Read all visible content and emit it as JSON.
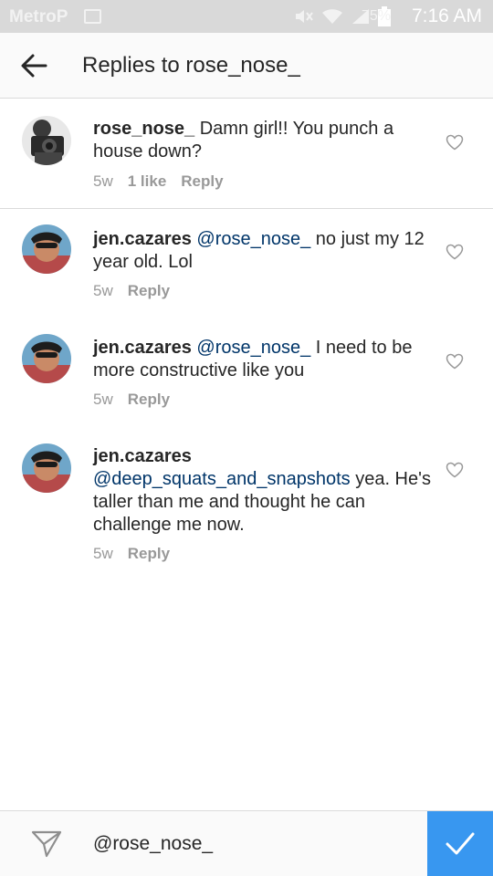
{
  "status_bar": {
    "carrier": "MetroP",
    "battery_text": "75%",
    "time": "7:16 AM"
  },
  "header": {
    "title": "Replies to rose_nose_"
  },
  "comments": [
    {
      "username": "rose_nose_",
      "mention": "",
      "text": " Damn girl!! You punch a house down?",
      "time": "5w",
      "likes": "1 like",
      "reply_label": "Reply",
      "avatar": "camera-photo"
    },
    {
      "username": "jen.cazares",
      "mention": "@rose_nose_",
      "text": " no just my 12 year old. Lol",
      "time": "5w",
      "likes": "",
      "reply_label": "Reply",
      "avatar": "selfie-photo"
    },
    {
      "username": "jen.cazares",
      "mention": "@rose_nose_",
      "text": " I need to be more constructive like you",
      "time": "5w",
      "likes": "",
      "reply_label": "Reply",
      "avatar": "selfie-photo"
    },
    {
      "username": "jen.cazares",
      "mention": "@deep_squats_and_snapshots",
      "text": " yea. He's taller than me and thought he can challenge me now.",
      "time": "5w",
      "likes": "",
      "reply_label": "Reply",
      "avatar": "selfie-photo"
    }
  ],
  "compose": {
    "value": "@rose_nose_"
  },
  "colors": {
    "accent": "#3897f0",
    "mention": "#003569",
    "meta": "#999999"
  }
}
